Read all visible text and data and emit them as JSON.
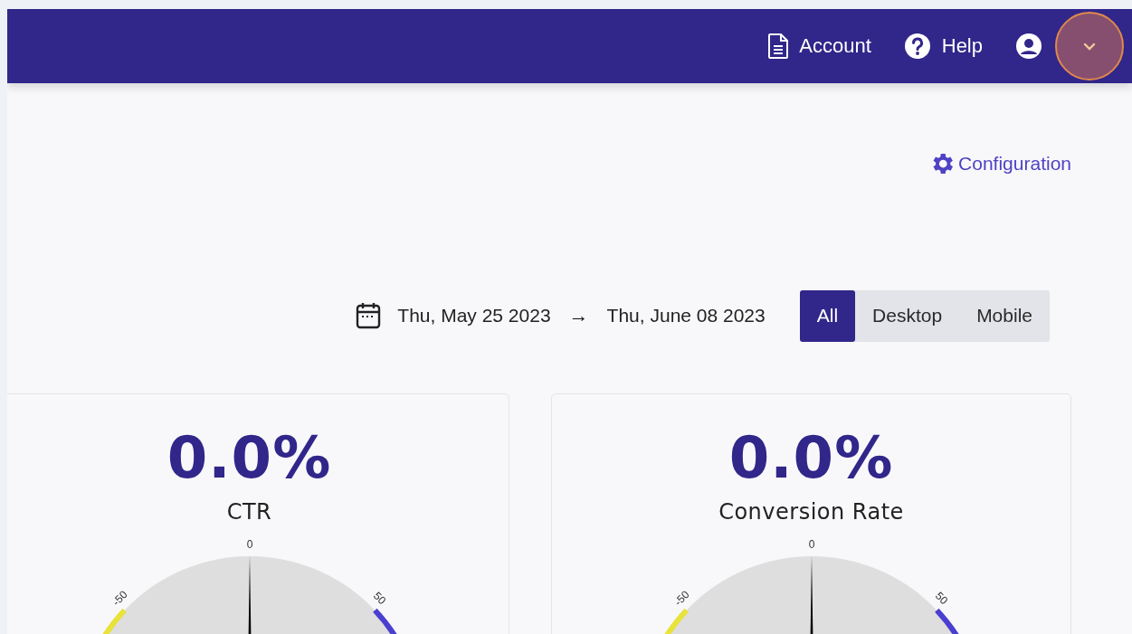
{
  "header": {
    "nav": [
      {
        "kind": "document",
        "label": "Account"
      },
      {
        "kind": "help",
        "label": "Help"
      }
    ],
    "user_menu": {
      "expanded": false
    }
  },
  "configuration_link": {
    "label": "Configuration"
  },
  "date_range": {
    "start": "Thu, May 25 2023",
    "arrow": "→",
    "end": "Thu, June 08 2023"
  },
  "device_filter": [
    {
      "label": "All",
      "selected": true
    },
    {
      "label": "Desktop",
      "selected": false
    },
    {
      "label": "Mobile",
      "selected": false
    }
  ],
  "metrics": [
    {
      "value": "0.0%",
      "label": "CTR",
      "gauge": {
        "ticks": [
          "-50",
          "0",
          "50"
        ],
        "level": 0.5
      }
    },
    {
      "value": "0.0%",
      "label": "Conversion Rate",
      "gauge": {
        "ticks": [
          "-50",
          "0",
          "50"
        ],
        "level": 0.5
      }
    }
  ]
}
